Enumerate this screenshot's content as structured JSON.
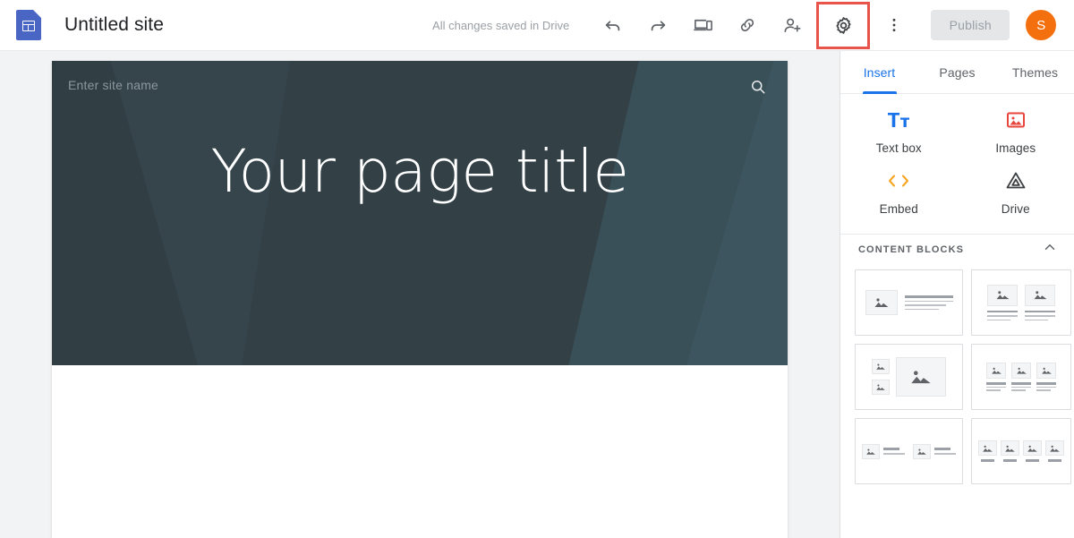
{
  "topbar": {
    "app_logo_name": "google-sites-logo",
    "site_title": "Untitled site",
    "save_status": "All changes saved in Drive",
    "undo_label": "Undo",
    "redo_label": "Redo",
    "preview_label": "Preview",
    "link_label": "Copy site link",
    "share_label": "Add editors",
    "settings_label": "Settings",
    "more_label": "More",
    "publish_label": "Publish",
    "avatar_initial": "S",
    "avatar_color": "#f4700f",
    "highlight_color": "#e8544a"
  },
  "canvas": {
    "site_name_placeholder": "Enter site name",
    "page_title": "Your page title",
    "search_label": "Search this site",
    "banner_color": "#2f3c42"
  },
  "panel": {
    "tabs": [
      {
        "label": "Insert",
        "active": true
      },
      {
        "label": "Pages",
        "active": false
      },
      {
        "label": "Themes",
        "active": false
      }
    ],
    "accent_color": "#1a73e8",
    "insert_items": [
      {
        "label": "Text box",
        "icon": "text-box-icon"
      },
      {
        "label": "Images",
        "icon": "images-icon"
      },
      {
        "label": "Embed",
        "icon": "embed-icon"
      },
      {
        "label": "Drive",
        "icon": "drive-icon"
      }
    ],
    "content_blocks": {
      "title": "CONTENT BLOCKS",
      "collapse_icon": "chevron-up-icon",
      "items": [
        {
          "name": "image-left-text-right"
        },
        {
          "name": "two-images-with-text"
        },
        {
          "name": "two-small-images-one-large"
        },
        {
          "name": "three-images-with-text"
        },
        {
          "name": "two-image-text-pairs"
        },
        {
          "name": "four-images-with-captions"
        }
      ]
    }
  }
}
